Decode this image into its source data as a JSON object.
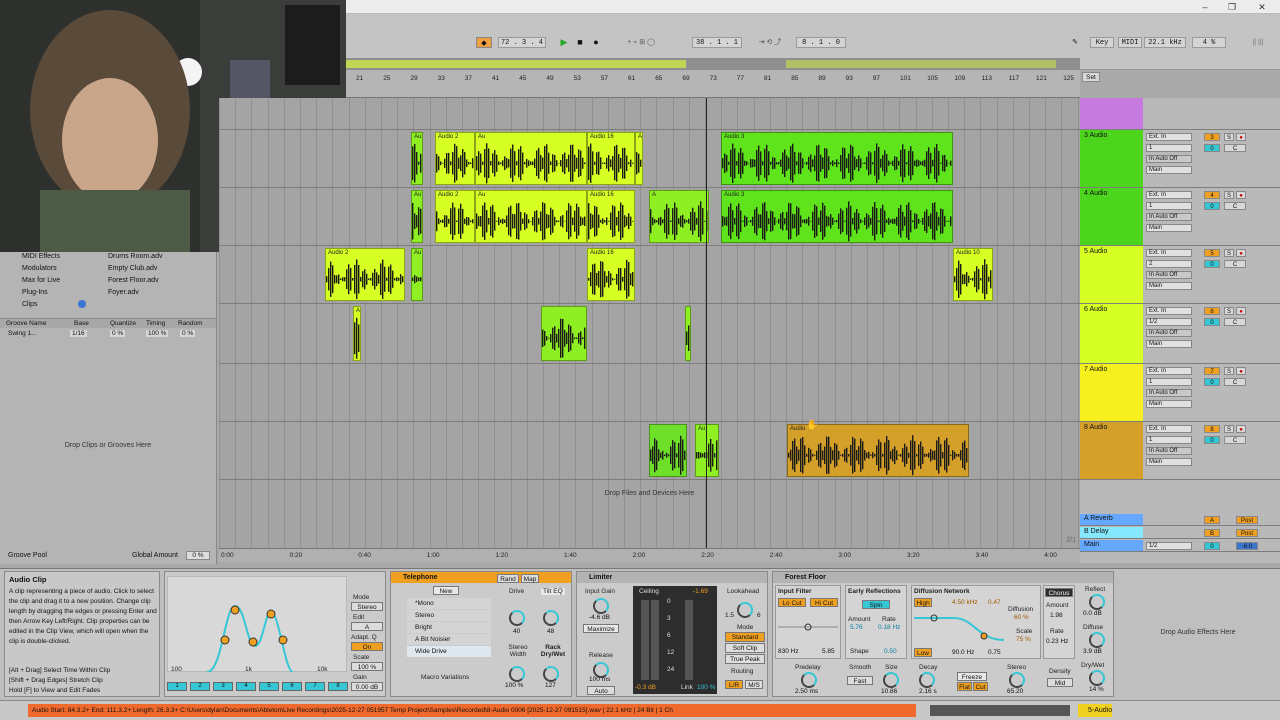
{
  "window": {
    "min": "–",
    "restore": "❐",
    "close": "✕"
  },
  "transport": {
    "follow": "◆",
    "tempo": "72 . 3 . 4",
    "play": "▶",
    "stop": "■",
    "record": "●",
    "position": "38 . 1 . 1",
    "loop_length": "8 . 1 . 0",
    "key_label": "Key",
    "midi_label": "MIDI",
    "sample_rate": "22.1 kHz",
    "cpu": "4 %"
  },
  "ruler": {
    "ticks": [
      "21",
      "25",
      "29",
      "33",
      "37",
      "41",
      "45",
      "49",
      "53",
      "57",
      "61",
      "65",
      "69",
      "73",
      "77",
      "81",
      "85",
      "89",
      "93",
      "97",
      "101",
      "105",
      "109",
      "113",
      "117",
      "121",
      "125"
    ],
    "set_label": "Set"
  },
  "time_axis": {
    "ticks": [
      "0:00",
      "0:20",
      "0:40",
      "1:00",
      "1:20",
      "1:40",
      "2:00",
      "2:20",
      "2:40",
      "3:00",
      "3:20",
      "3:40",
      "4:00"
    ],
    "page": "2/1"
  },
  "tracks": [
    {
      "name": "",
      "color": "#c77be0",
      "clips": []
    },
    {
      "name": "3 Audio",
      "color": "#4dd41c",
      "input": "Ext. In",
      "channel": "1",
      "out": "Main",
      "num": "3",
      "clips": [
        {
          "label": "Au",
          "color": "#8ef022"
        },
        {
          "label": "Audio 2",
          "color": "#d6ff24"
        },
        {
          "label": "Au",
          "color": "#d6ff24"
        },
        {
          "label": "Audio 16",
          "color": "#d6ff24"
        },
        {
          "label": "A",
          "color": "#d6ff24"
        },
        {
          "label": "Audio 3",
          "color": "#5fe41c"
        }
      ]
    },
    {
      "name": "4 Audio",
      "color": "#4dd41c",
      "input": "Ext. In",
      "channel": "1",
      "out": "Main",
      "num": "4",
      "clips": [
        {
          "label": "Au",
          "color": "#8ef022"
        },
        {
          "label": "Audio 2",
          "color": "#d6ff24"
        },
        {
          "label": "Au",
          "color": "#d6ff24"
        },
        {
          "label": "Audio 16",
          "color": "#d6ff24"
        },
        {
          "label": "A",
          "color": "#8ef022"
        },
        {
          "label": "Audio 3",
          "color": "#5fe41c"
        }
      ]
    },
    {
      "name": "5 Audio",
      "color": "#d6ff24",
      "input": "Ext. In",
      "channel": "2",
      "out": "Main",
      "num": "5",
      "clips": [
        {
          "label": "Audio 2",
          "color": "#d6ff24"
        },
        {
          "label": "Au",
          "color": "#8ef022"
        },
        {
          "label": "Audio 16",
          "color": "#d6ff24"
        },
        {
          "label": "Audio 10",
          "color": "#d6ff24"
        }
      ]
    },
    {
      "name": "6 Audio",
      "color": "#d6ff24",
      "input": "Ext. In",
      "channel": "1/2",
      "out": "Main",
      "num": "6",
      "clips": [
        {
          "label": "A",
          "color": "#d6ff24"
        },
        {
          "label": "",
          "color": "#8ef022"
        },
        {
          "label": "",
          "color": "#8ef022"
        }
      ]
    },
    {
      "name": "7 Audio",
      "color": "#f5f01e",
      "input": "Ext. In",
      "channel": "1",
      "out": "Main",
      "num": "7",
      "clips": []
    },
    {
      "name": "8 Audio",
      "color": "#d4a02a",
      "input": "Ext. In",
      "channel": "1",
      "out": "Main",
      "num": "8",
      "clips": [
        {
          "label": "",
          "color": "#6fe02a"
        },
        {
          "label": "Au",
          "color": "#8ef022"
        },
        {
          "label": "Audio",
          "color": "#d4a02a"
        }
      ]
    }
  ],
  "drop_files": "Drop Files and Devices Here",
  "returns": [
    {
      "name": "A Reverb",
      "color": "#66a8ff",
      "num": "A",
      "send": "Post"
    },
    {
      "name": "B Delay",
      "color": "#86e8ff",
      "num": "B",
      "send": "Post"
    },
    {
      "name": "Main",
      "color": "#66a8ff",
      "num": "0",
      "send": "-6.0",
      "channel": "1/2"
    }
  ],
  "browser": {
    "categories": [
      "MIDI Effects",
      "Modulators",
      "Max for Live",
      "Plug-Ins",
      "Clips"
    ],
    "files": [
      "Drums Room.adv",
      "Empty Club.adv",
      "Forest Floor.adv",
      "Foyer.adv"
    ],
    "groove_headers": [
      "Groove Name",
      "Base",
      "Quantize",
      "Timing",
      "Random"
    ],
    "groove_row": [
      "Swing 1...",
      "1/16",
      "0 %",
      "100 %",
      "0 %"
    ],
    "drop_clips": "Drop Clips or Grooves Here",
    "groove_pool": "Groove Pool",
    "global_amount_label": "Global Amount",
    "global_amount": "0 %"
  },
  "info": {
    "title": "Audio Clip",
    "body": "A clip representing a piece of audio. Click to select the clip and drag it to a new position. Change clip length by dragging the edges or pressing Enter and then Arrow Key Left/Right. Clip properties can be edited in the Clip View, which will open when the clip is double-clicked.",
    "hints": [
      "[Alt + Drag] Select Time Within Clip",
      "[Shift + Drag Edges] Stretch Clip",
      "Hold [F] to View and Edit Fades"
    ]
  },
  "eq": {
    "x_labels": [
      "100",
      "1k",
      "10k"
    ],
    "mode_label": "Mode",
    "mode": "Stereo",
    "edit_label": "Edit",
    "edit": "A",
    "adapt_label": "Adapt. Q",
    "adapt": "On",
    "scale_label": "Scale",
    "scale": "100 %",
    "gain_label": "Gain",
    "gain": "0.00 dB",
    "bands": [
      "1",
      "2",
      "3",
      "4",
      "5",
      "6",
      "7",
      "8"
    ]
  },
  "telephone": {
    "title": "Telephone",
    "new": "New",
    "presets": [
      "*Mono",
      "Stereo",
      "Bright",
      "A Bit Noisier",
      "Wide Drive"
    ],
    "rand": "Rand",
    "map": "Map",
    "drive_label": "Drive",
    "drive": "40",
    "tilt_label": "Tilt EQ",
    "tilt": "48",
    "stereo_label": "Stereo Width",
    "stereo": "100 %",
    "rack_label": "Rack Dry/Wet",
    "rack": "127",
    "macro": "Macro Variations"
  },
  "limiter": {
    "title": "Limiter",
    "input_gain_label": "Input Gain",
    "input_gain": "-4.6 dB",
    "maximize": "Maximize",
    "release_label": "Release",
    "release": "100 ms",
    "auto": "Auto",
    "ceiling_label": "Ceiling",
    "ceiling": "-0.3 dB",
    "meter_peak": "-1.69",
    "scale": [
      "0",
      "3",
      "6",
      "12",
      "24"
    ],
    "link_label": "Link",
    "link": "100 %",
    "lookahead_label": "Lookahead",
    "lookahead_ticks": [
      "1.5",
      "6"
    ],
    "mode_label": "Mode",
    "modes": [
      "Standard",
      "Soft Clip",
      "True Peak"
    ],
    "routing_label": "Routing",
    "routing": [
      "L/R",
      "M/S"
    ]
  },
  "reverb": {
    "title": "Forest Floor",
    "input_filter": "Input Filter",
    "lo_cut": "Lo Cut",
    "hi_cut": "Hi Cut",
    "filter_lo": "830 Hz",
    "filter_q": "5.85",
    "early": "Early Reflections",
    "spin": "Spin",
    "amount_label": "Amount",
    "amount": "5.76",
    "rate_label": "Rate",
    "rate": "0.18 Hz",
    "shape_label": "Shape",
    "shape": "0.50",
    "diffusion_net": "Diffusion Network",
    "high": "High",
    "high_freq": "4.50 kHz",
    "high_val": "0.47",
    "low": "Low",
    "low_freq": "90.0 Hz",
    "low_val": "0.75",
    "diffusion_label": "Diffusion",
    "diffusion": "60 %",
    "scale_label": "Scale",
    "scale": "75 %",
    "chorus": "Chorus",
    "ch_amount_label": "Amount",
    "ch_amount": "1.98",
    "ch_rate_label": "Rate",
    "ch_rate": "0.23 Hz",
    "predelay_label": "Predelay",
    "predelay": "2.50 ms",
    "smooth_label": "Smooth",
    "smooth": "Fast",
    "size_label": "Size",
    "size": "10.86",
    "decay_label": "Decay",
    "decay": "2.16 s",
    "freeze": "Freeze",
    "flat": "Flat",
    "cut": "Cut",
    "stereo_label": "Stereo",
    "stereo": "65.20",
    "density_label": "Density",
    "density": "Mid",
    "reflect_label": "Reflect",
    "reflect": "0.0 dB",
    "diffuse_label": "Diffuse",
    "diffuse": "3.9 dB",
    "drywet_label": "Dry/Wet",
    "drywet": "14 %"
  },
  "drop_effects": "Drop Audio Effects Here",
  "status": {
    "text": "Audio Start: 84.3.2+ End: 111.3.2+ Length: 26.3.3+ C:\\Users\\dylan\\Documents\\Ableton\\Live Recordings\\2025-12-27 051957 Temp Project\\Samples\\Recorded\\8-Audio 0006 [2025-12-27 091515].wav | 22.1 kHz | 24 Bit | 1 Ch",
    "track": "5-Audio"
  }
}
